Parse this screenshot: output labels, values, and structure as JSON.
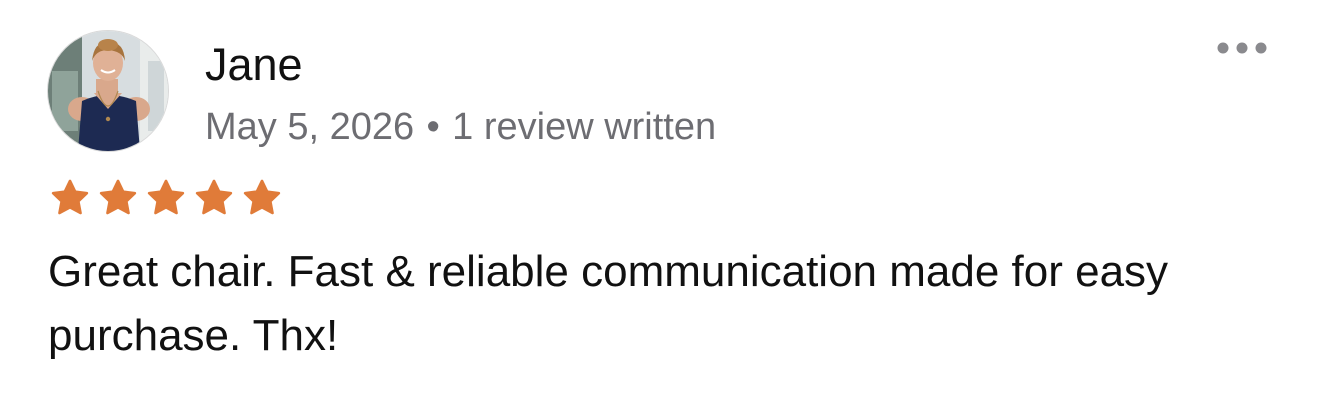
{
  "review": {
    "reviewer_name": "Jane",
    "date": "May 5, 2026",
    "separator": "•",
    "review_count_text": "1 review written",
    "rating": 5,
    "rating_max": 5,
    "text": "Great chair. Fast & reliable communication made for easy purchase. Thx!",
    "avatar_icon": "person-photo",
    "more_icon": "more-horizontal-icon"
  },
  "colors": {
    "star": "#E07B39",
    "meta_text": "#6D6D72",
    "primary_text": "#111111",
    "more_dots": "#8A8A8E"
  }
}
